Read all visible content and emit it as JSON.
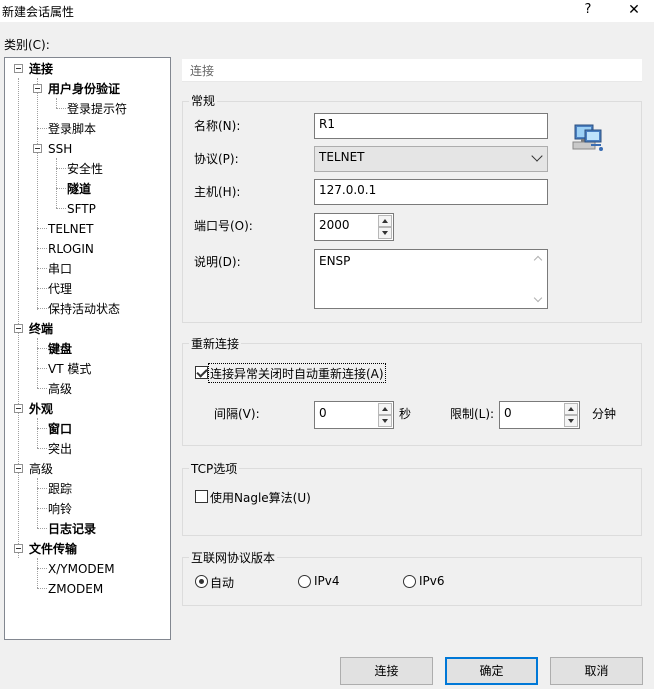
{
  "window": {
    "title": "新建会话属性",
    "help_glyph": "?",
    "close_glyph": "✕"
  },
  "category_label": "类别(C):",
  "tree": [
    {
      "label": "连接",
      "bold": true
    },
    {
      "label": "用户身份验证",
      "bold": true
    },
    {
      "label": "登录提示符",
      "bold": false
    },
    {
      "label": "登录脚本",
      "bold": false
    },
    {
      "label": "SSH",
      "bold": false
    },
    {
      "label": "安全性",
      "bold": false
    },
    {
      "label": "隧道",
      "bold": true
    },
    {
      "label": "SFTP",
      "bold": false
    },
    {
      "label": "TELNET",
      "bold": false
    },
    {
      "label": "RLOGIN",
      "bold": false
    },
    {
      "label": "串口",
      "bold": false
    },
    {
      "label": "代理",
      "bold": false
    },
    {
      "label": "保持活动状态",
      "bold": false
    },
    {
      "label": "终端",
      "bold": true
    },
    {
      "label": "键盘",
      "bold": true
    },
    {
      "label": "VT 模式",
      "bold": false
    },
    {
      "label": "高级",
      "bold": false
    },
    {
      "label": "外观",
      "bold": true
    },
    {
      "label": "窗口",
      "bold": true
    },
    {
      "label": "突出",
      "bold": false
    },
    {
      "label": "高级",
      "bold": false
    },
    {
      "label": "跟踪",
      "bold": false
    },
    {
      "label": "响铃",
      "bold": false
    },
    {
      "label": "日志记录",
      "bold": true
    },
    {
      "label": "文件传输",
      "bold": true
    },
    {
      "label": "X/YMODEM",
      "bold": false
    },
    {
      "label": "ZMODEM",
      "bold": false
    }
  ],
  "panel": {
    "header": "连接",
    "general": {
      "title": "常规",
      "name_label": "名称(N):",
      "name_value": "R1",
      "protocol_label": "协议(P):",
      "protocol_value": "TELNET",
      "host_label": "主机(H):",
      "host_value": "127.0.0.1",
      "port_label": "端口号(O):",
      "port_value": "2000",
      "desc_label": "说明(D):",
      "desc_value": "ENSP",
      "icon": "computer-network-icon"
    },
    "reconnect": {
      "title": "重新连接",
      "auto_label": "连接异常关闭时自动重新连接(A)",
      "auto_checked": true,
      "interval_label": "间隔(V):",
      "interval_value": "0",
      "interval_unit": "秒",
      "limit_label": "限制(L):",
      "limit_value": "0",
      "limit_unit": "分钟"
    },
    "tcp": {
      "title": "TCP选项",
      "nagle_label": "使用Nagle算法(U)",
      "nagle_checked": false
    },
    "ip": {
      "title": "互联网协议版本",
      "options": [
        "自动",
        "IPv4",
        "IPv6"
      ],
      "selected": "自动"
    }
  },
  "buttons": {
    "connect": "连接",
    "ok": "确定",
    "cancel": "取消"
  },
  "colors": {
    "dialog_bg": "#f0f0f0",
    "focus_blue": "#0078d7",
    "border": "#7a7a7a"
  }
}
